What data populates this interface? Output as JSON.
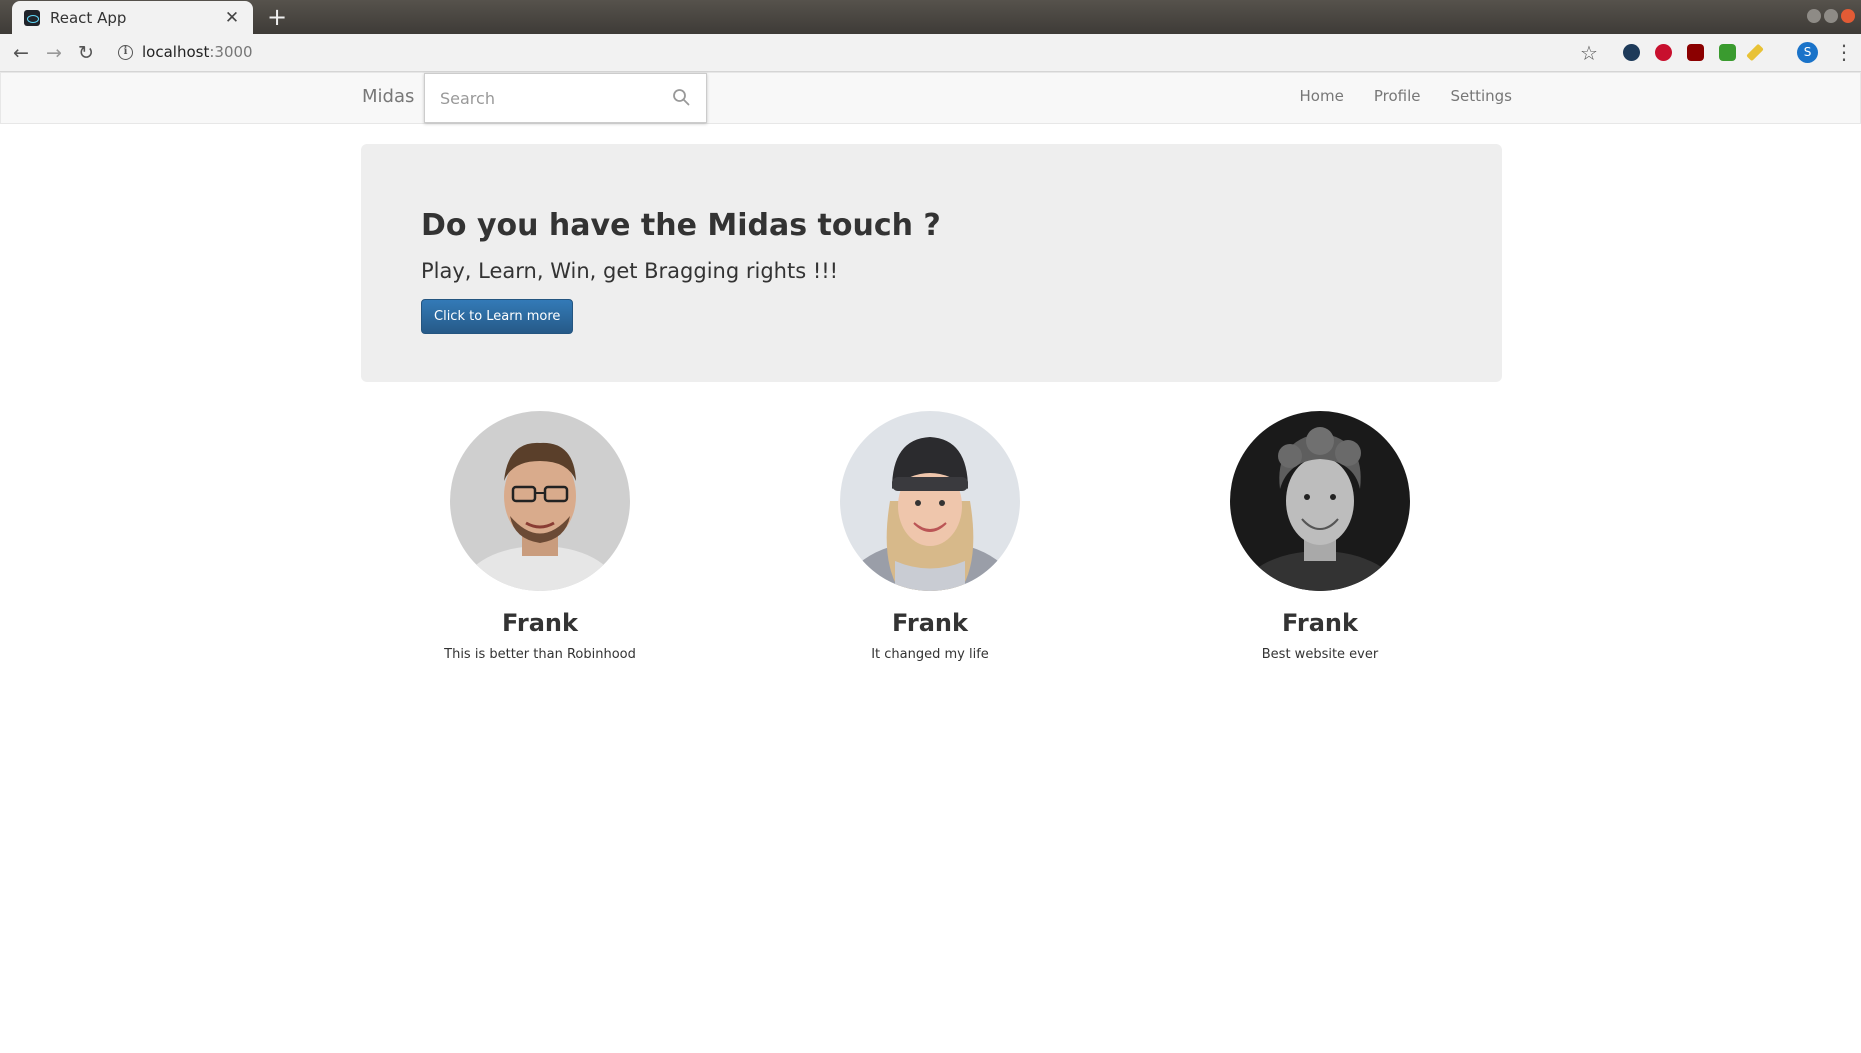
{
  "browser": {
    "tab_title": "React App",
    "url_host": "localhost",
    "url_port": ":3000",
    "profile_initial": "S"
  },
  "navbar": {
    "brand": "Midas",
    "search_placeholder": "Search",
    "links": [
      "Home",
      "Profile",
      "Settings"
    ]
  },
  "hero": {
    "title": "Do you have the Midas touch ?",
    "subtitle": "Play, Learn, Win, get Bragging rights !!!",
    "button_label": "Click to Learn more",
    "button_color": "#337ab7"
  },
  "testimonials": [
    {
      "name": "Frank",
      "quote": "This is better than Robinhood"
    },
    {
      "name": "Frank",
      "quote": "It changed my life"
    },
    {
      "name": "Frank",
      "quote": "Best website ever"
    }
  ]
}
